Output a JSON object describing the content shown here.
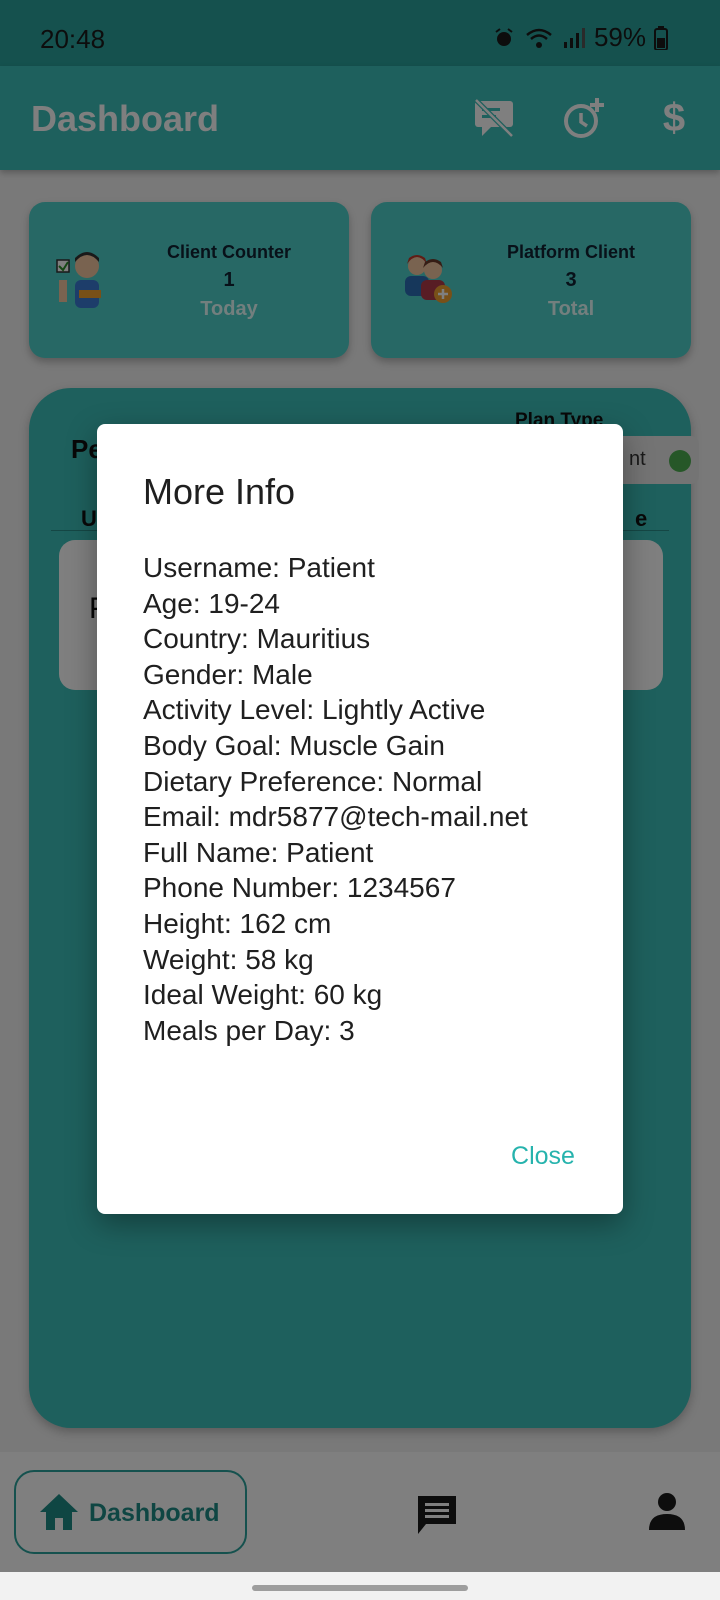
{
  "status_bar": {
    "time": "20:48",
    "battery": "59%"
  },
  "app_bar": {
    "title": "Dashboard",
    "icons": [
      "message-off-icon",
      "timer-add-icon",
      "dollar-icon"
    ],
    "dollar_symbol": "$"
  },
  "stats": [
    {
      "title": "Client Counter",
      "value": "1",
      "sub": "Today",
      "icon": "client-person-icon"
    },
    {
      "title": "Platform Client",
      "value": "3",
      "sub": "Total",
      "icon": "people-add-icon"
    }
  ],
  "panel": {
    "heading": "Pe",
    "plan_type_label": "Plan Type",
    "plan_toggle_text": "nt",
    "col_left": "U",
    "col_right": "e",
    "row_text": "P"
  },
  "dialog": {
    "title": "More Info",
    "info_lines": [
      "Username: Patient",
      "Age: 19-24",
      "Country: Mauritius",
      "Gender: Male",
      "Activity Level: Lightly Active",
      "Body Goal: Muscle Gain",
      "Dietary Preference: Normal",
      "Email: mdr5877@tech-mail.net",
      "Full Name: Patient",
      "Phone Number: 1234567",
      "Height: 162 cm",
      "Weight: 58 kg",
      "Ideal Weight: 60 kg",
      "Meals per Day: 3"
    ],
    "close_label": "Close"
  },
  "bottom_nav": {
    "home_label": "Dashboard",
    "icons": [
      "home-icon",
      "chat-icon",
      "profile-icon"
    ]
  },
  "colors": {
    "teal": "#3dc0ba",
    "accent": "#26b3ad",
    "toggle_on": "#4caf50"
  }
}
